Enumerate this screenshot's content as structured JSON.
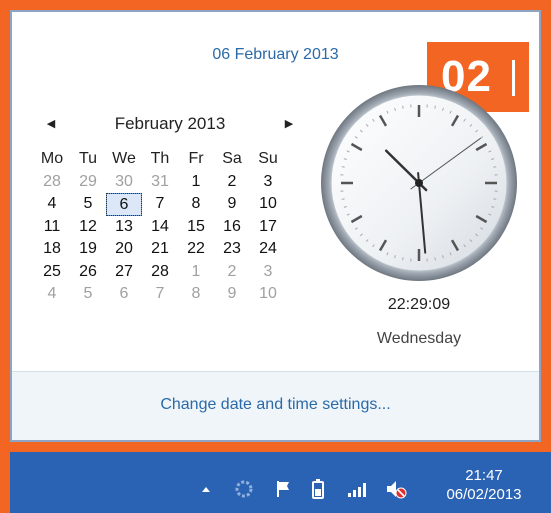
{
  "step_badge": "02",
  "flyout": {
    "date_header": "06 February 2013",
    "calendar": {
      "month_title": "February 2013",
      "prev_icon": "triangle-left-icon",
      "next_icon": "triangle-right-icon",
      "weekdays": [
        "Mo",
        "Tu",
        "We",
        "Th",
        "Fr",
        "Sa",
        "Su"
      ],
      "weeks": [
        [
          {
            "d": "28",
            "other": true
          },
          {
            "d": "29",
            "other": true
          },
          {
            "d": "30",
            "other": true
          },
          {
            "d": "31",
            "other": true
          },
          {
            "d": "1"
          },
          {
            "d": "2"
          },
          {
            "d": "3"
          }
        ],
        [
          {
            "d": "4"
          },
          {
            "d": "5"
          },
          {
            "d": "6",
            "today": true
          },
          {
            "d": "7"
          },
          {
            "d": "8"
          },
          {
            "d": "9"
          },
          {
            "d": "10"
          }
        ],
        [
          {
            "d": "11"
          },
          {
            "d": "12"
          },
          {
            "d": "13"
          },
          {
            "d": "14"
          },
          {
            "d": "15"
          },
          {
            "d": "16"
          },
          {
            "d": "17"
          }
        ],
        [
          {
            "d": "18"
          },
          {
            "d": "19"
          },
          {
            "d": "20"
          },
          {
            "d": "21"
          },
          {
            "d": "22"
          },
          {
            "d": "23"
          },
          {
            "d": "24"
          }
        ],
        [
          {
            "d": "25"
          },
          {
            "d": "26"
          },
          {
            "d": "27"
          },
          {
            "d": "28"
          },
          {
            "d": "1",
            "other": true
          },
          {
            "d": "2",
            "other": true
          },
          {
            "d": "3",
            "other": true
          }
        ],
        [
          {
            "d": "4",
            "other": true
          },
          {
            "d": "5",
            "other": true
          },
          {
            "d": "6",
            "other": true
          },
          {
            "d": "7",
            "other": true
          },
          {
            "d": "8",
            "other": true
          },
          {
            "d": "9",
            "other": true
          },
          {
            "d": "10",
            "other": true
          }
        ]
      ]
    },
    "clock": {
      "hours": 22,
      "minutes": 29,
      "seconds": 9
    },
    "time_text": "22:29:09",
    "day_text": "Wednesday",
    "settings_link": "Change date and time settings..."
  },
  "taskbar": {
    "tray_icons": [
      "chevron-up-icon",
      "network-activity-icon",
      "flag-icon",
      "battery-icon",
      "signal-bars-icon",
      "speaker-muted-icon"
    ],
    "time": "21:47",
    "date": "06/02/2013"
  },
  "colors": {
    "accent_orange": "#f26522",
    "link_blue": "#2a6aa8",
    "taskbar_blue": "#2a63b4"
  }
}
